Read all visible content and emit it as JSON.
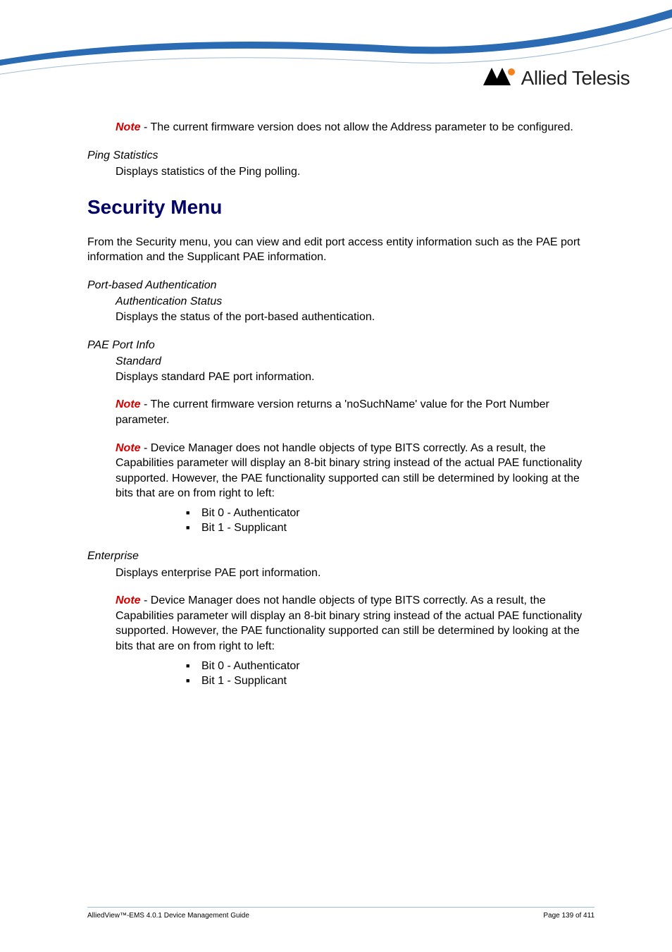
{
  "logo": {
    "brand": "Allied Telesis"
  },
  "notes": {
    "note_label": "Note",
    "firmware_address": " - The current firmware version does not allow the Address parameter to be configured.",
    "firmware_nosuchname": " - The current firmware version returns a 'noSuchName' value for the Port Number parameter.",
    "bits_warning": " - Device Manager does not handle objects of type BITS correctly. As a result, the Capabilities parameter will display an 8-bit binary string instead of the actual PAE functionality supported. However, the PAE functionality supported can still be determined by looking at the bits that are on from right to left:"
  },
  "ping_statistics": {
    "heading": "Ping Statistics",
    "body": "Displays statistics of the Ping polling."
  },
  "security_menu": {
    "heading": "Security Menu",
    "intro": "From the Security menu, you can view and edit port access entity information such as the PAE port information and the Supplicant PAE information."
  },
  "port_based_auth": {
    "heading": "Port-based Authentication",
    "sub_heading": "Authentication Status",
    "body": "Displays the status of the port-based authentication."
  },
  "pae_port_info": {
    "heading": "PAE Port Info",
    "sub_heading": "Standard",
    "body": "Displays standard PAE port information."
  },
  "enterprise": {
    "heading": "Enterprise",
    "body": "Displays enterprise PAE port information."
  },
  "bits": {
    "b0": "Bit 0 - Authenticator",
    "b1": "Bit 1 - Supplicant"
  },
  "footer": {
    "left": "AlliedView™-EMS 4.0.1 Device Management Guide",
    "right": "Page 139 of 411"
  }
}
